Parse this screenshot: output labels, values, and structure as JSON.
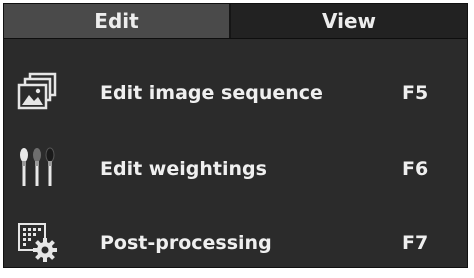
{
  "menubar": {
    "tabs": [
      {
        "label": "Edit",
        "active": true
      },
      {
        "label": "View",
        "active": false
      }
    ]
  },
  "menu": {
    "items": [
      {
        "label": "Edit image sequence",
        "shortcut": "F5",
        "icon": "image-stack-icon"
      },
      {
        "label": "Edit weightings",
        "shortcut": "F6",
        "icon": "brushes-icon"
      },
      {
        "label": "Post-processing",
        "shortcut": "F7",
        "icon": "grid-gear-icon"
      }
    ]
  },
  "colors": {
    "background": "#2b2b2b",
    "active_tab": "#4a4a4a",
    "menubar": "#1f1f1f",
    "text": "#efefef"
  }
}
